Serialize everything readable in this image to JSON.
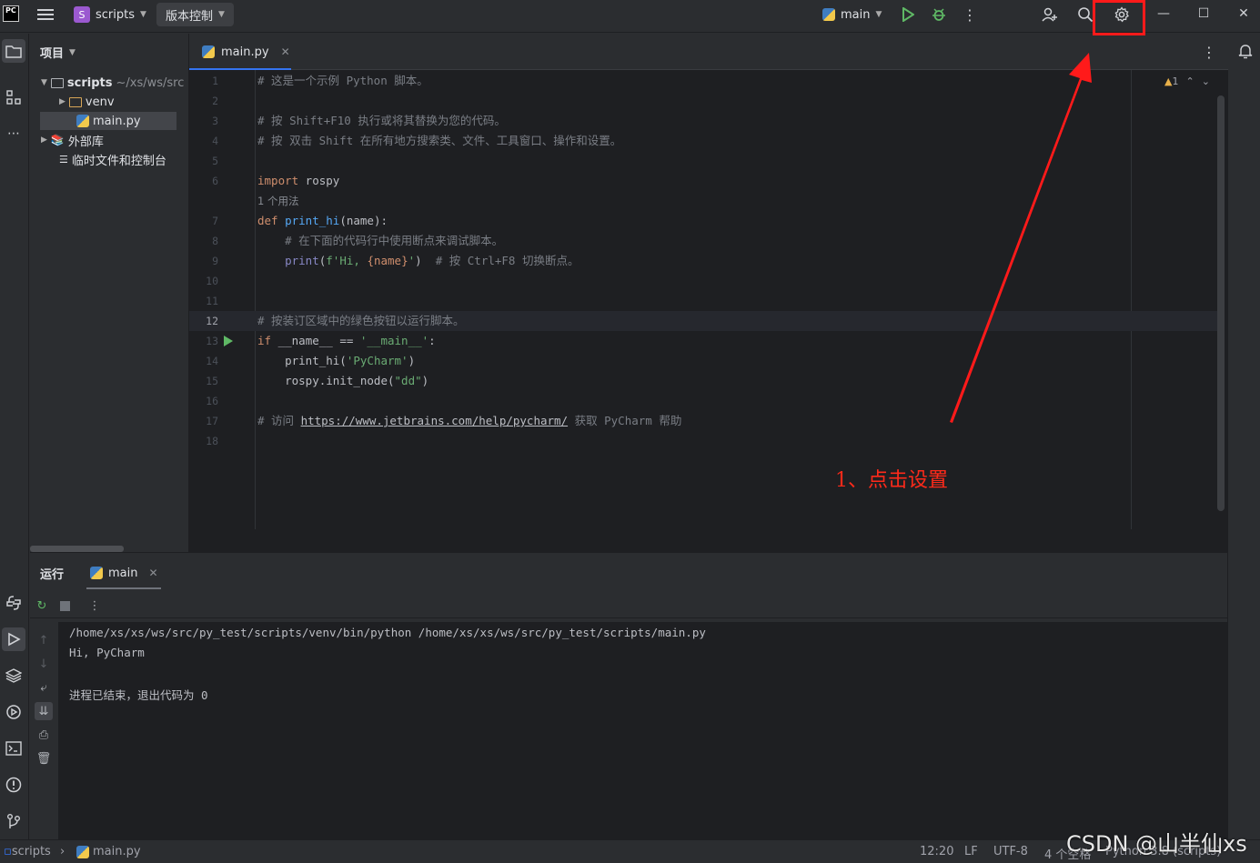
{
  "titlebar": {
    "logo": "PC",
    "project_badge": "S",
    "project_name": "scripts",
    "vcs_label": "版本控制",
    "run_config": "main"
  },
  "project_panel": {
    "title": "项目",
    "tree": [
      {
        "label": "scripts",
        "hint": "~/xs/ws/src",
        "expanded": true
      },
      {
        "label": "venv",
        "expanded": false
      },
      {
        "label": "main.py",
        "selected": true
      },
      {
        "label": "外部库",
        "expanded": false
      },
      {
        "label": "临时文件和控制台"
      }
    ]
  },
  "editor": {
    "tab_label": "main.py",
    "warning_count": "1",
    "line_numbers": [
      "1",
      "2",
      "3",
      "4",
      "5",
      "6",
      "7",
      "8",
      "9",
      "10",
      "11",
      "12",
      "13",
      "14",
      "15",
      "16",
      "17",
      "18"
    ],
    "usage_hint": "1 个用法",
    "lines": {
      "l1": "# 这是一个示例 Python 脚本。",
      "l3": "# 按 Shift+F10 执行或将其替换为您的代码。",
      "l4": "# 按 双击 Shift 在所有地方搜索类、文件、工具窗口、操作和设置。",
      "l6_kw": "import",
      "l6_rest": " rospy",
      "l7_kw": "def",
      "l7_fn": "print_hi",
      "l7_rest": "(name):",
      "l8": "    # 在下面的代码行中使用断点来调试脚本。",
      "l9_builtin": "print",
      "l9_a": "(",
      "l9_str1": "f'Hi, ",
      "l9_var": "{name}",
      "l9_str2": "'",
      "l9_b": ")  ",
      "l9_cmt": "# 按 Ctrl+F8 切换断点。",
      "l12": "# 按装订区域中的绿色按钮以运行脚本。",
      "l13_kw": "if",
      "l13_a": " __name__ == ",
      "l13_str": "'__main__'",
      "l13_b": ":",
      "l14_a": "    print_hi(",
      "l14_str": "'PyCharm'",
      "l14_b": ")",
      "l15_a": "    rospy.init_node(",
      "l15_str": "\"dd\"",
      "l15_b": ")",
      "l17_a": "# 访问 ",
      "l17_link": "https://www.jetbrains.com/help/pycharm/",
      "l17_b": " 获取 PyCharm 帮助"
    },
    "current_line": "12"
  },
  "annotation": "1、点击设置",
  "run_panel": {
    "title": "运行",
    "tab_label": "main",
    "output": [
      "/home/xs/xs/ws/src/py_test/scripts/venv/bin/python /home/xs/xs/ws/src/py_test/scripts/main.py",
      "Hi, PyCharm",
      "",
      "进程已结束，退出代码为 0"
    ]
  },
  "statusbar": {
    "breadcrumb_project": "scripts",
    "breadcrumb_file": "main.py",
    "position": "12:20",
    "line_sep": "LF",
    "encoding": "UTF-8",
    "indent": "4 个空格",
    "interpreter": "Python 3.8 (scripts)"
  },
  "watermark": "CSDN @山半仙xs",
  "colors": {
    "accent": "#3574f0",
    "highlight": "#ff1a1a",
    "run_green": "#5fb865"
  }
}
